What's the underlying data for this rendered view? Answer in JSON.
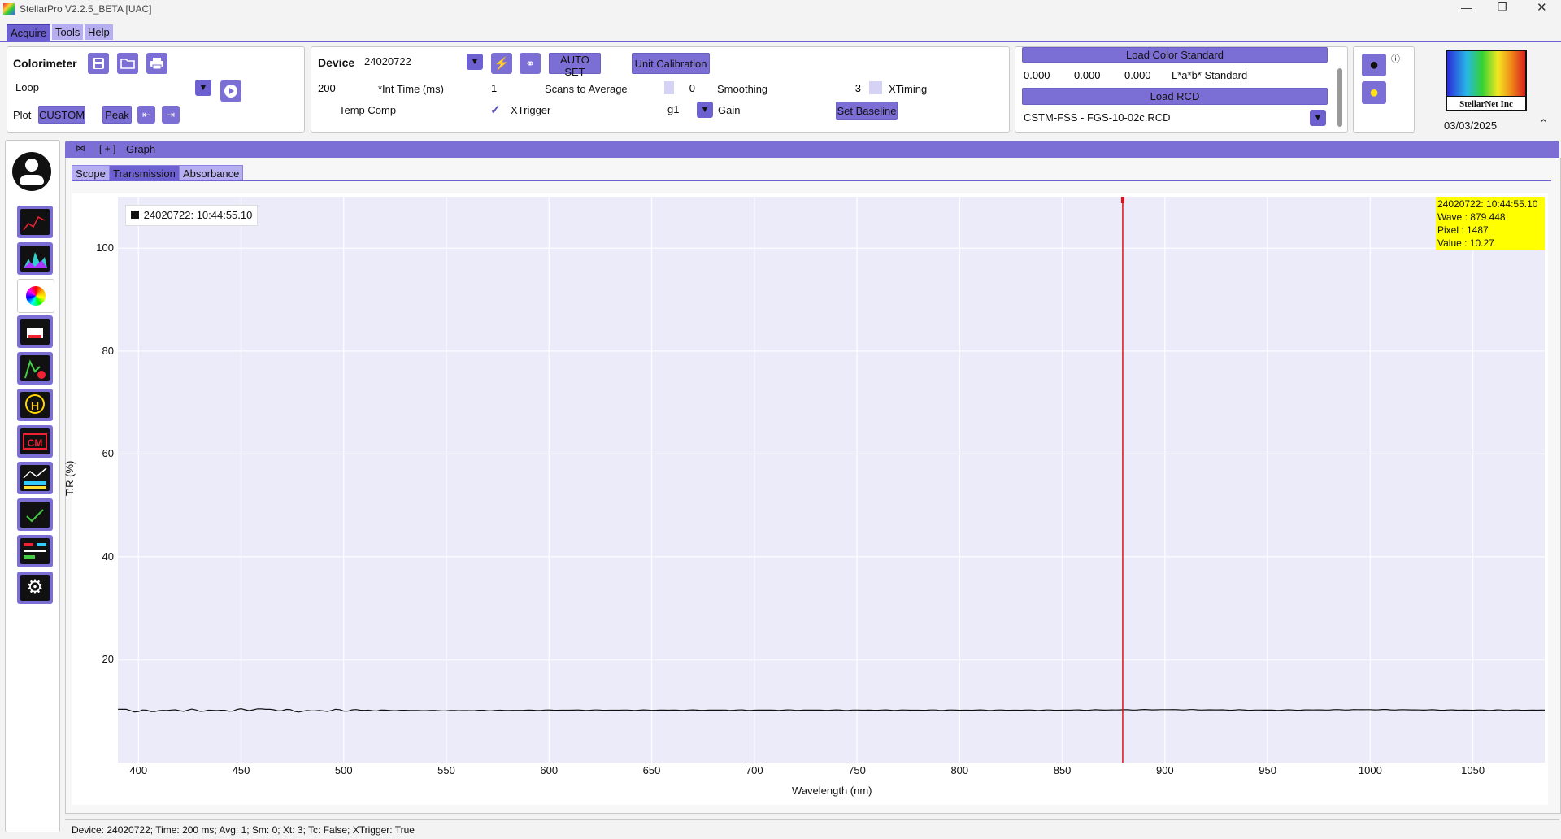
{
  "window": {
    "title": "StellarPro V2.2.5_BETA [UAC]"
  },
  "menu": [
    "Acquire",
    "Tools",
    "Help"
  ],
  "colorimeter": {
    "label": "Colorimeter",
    "mode": "Loop",
    "plot_label": "Plot",
    "custom": "CUSTOM",
    "peak": "Peak"
  },
  "device": {
    "label": "Device",
    "id": "24020722",
    "auto_set": "AUTO SET",
    "unit_calibration": "Unit Calibration",
    "int_time": "200",
    "int_time_label": "*Int Time (ms)",
    "scans": "1",
    "scans_label": "Scans to Average",
    "smoothing": "0",
    "smoothing_label": "Smoothing",
    "xtiming": "3",
    "xtiming_label": "XTiming",
    "temp_comp_label": "Temp Comp",
    "xtrigger_label": "XTrigger",
    "gain": "g1",
    "gain_label": "Gain",
    "set_baseline": "Set Baseline"
  },
  "color_standard": {
    "load_label": "Load Color Standard",
    "l": "0.000",
    "a": "0.000",
    "b": "0.000",
    "std_label": "L*a*b* Standard",
    "load_rcd": "Load RCD",
    "rcd_file": "CSTM-FSS - FGS-10-02c.RCD"
  },
  "logo": {
    "text": "StellarNet Inc",
    "date": "03/03/2025"
  },
  "graph": {
    "header": "Graph",
    "expand": "[ + ]",
    "tabs": [
      "Scope",
      "Transmission",
      "Absorbance"
    ],
    "active_tab": "Transmission",
    "legend": "24020722: 10:44:55.10",
    "cursor_info": [
      "24020722: 10:44:55.10",
      "Wave : 879.448",
      "Pixel : 1487",
      "Value : 10.27"
    ]
  },
  "status_bar": "Device: 24020722; Time: 200 ms; Avg: 1; Sm: 0; Xt: 3; Tc: False; XTrigger: True",
  "chart_data": {
    "type": "line",
    "xlabel": "Wavelength (nm)",
    "ylabel": "T:R (%)",
    "xlim": [
      390,
      1085
    ],
    "ylim": [
      0,
      110
    ],
    "xticks": [
      400,
      450,
      500,
      550,
      600,
      650,
      700,
      750,
      800,
      850,
      900,
      950,
      1000,
      1050
    ],
    "yticks": [
      20,
      40,
      60,
      80,
      100
    ],
    "cursor_x": 879.448,
    "series": [
      {
        "name": "24020722: 10:44:55.10",
        "x": [
          390,
          400,
          420,
          440,
          460,
          480,
          500,
          550,
          600,
          650,
          700,
          750,
          800,
          850,
          900,
          950,
          1000,
          1050,
          1085
        ],
        "y": [
          10.4,
          10.0,
          10.2,
          10.1,
          10.4,
          10.0,
          10.2,
          10.1,
          10.2,
          10.2,
          10.2,
          10.2,
          10.2,
          10.2,
          10.3,
          10.2,
          10.3,
          10.2,
          10.2
        ]
      }
    ]
  }
}
